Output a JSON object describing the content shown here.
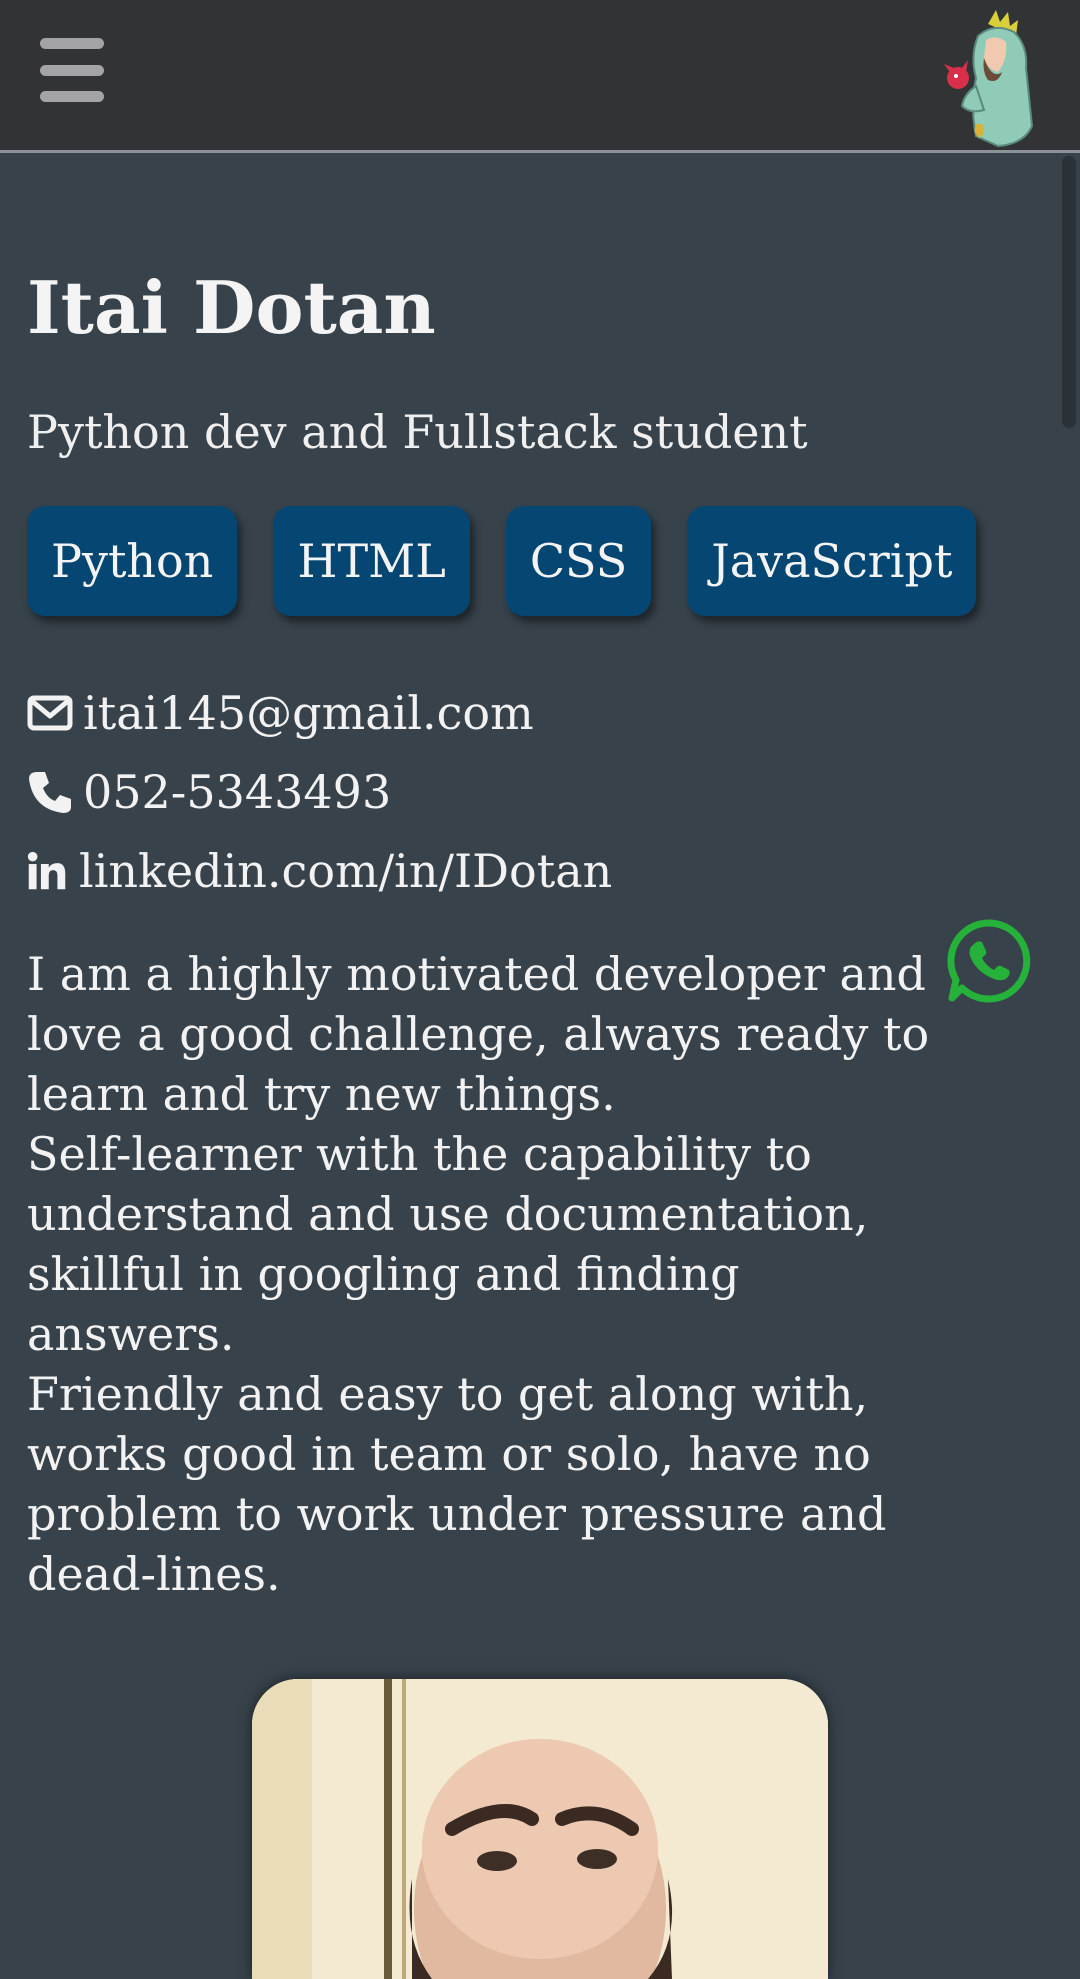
{
  "header": {
    "menu_icon": "hamburger-icon",
    "logo_icon": "character-logo-icon"
  },
  "profile": {
    "name": "Itai Dotan",
    "tagline": "Python dev and Fullstack student"
  },
  "skills": [
    "Python",
    "HTML",
    "CSS",
    "JavaScript"
  ],
  "contacts": {
    "email": "itai145@gmail.com",
    "phone": "052-5343493",
    "linkedin": "linkedin.com/in/IDotan"
  },
  "about": [
    "I am a highly motivated developer and love a good challenge, always ready to learn and try new things.",
    "Self-learner with the capability to understand and use documentation, skillful in googling and finding answers.",
    "Friendly and easy to get along with, works good in team or solo, have no problem to work under pressure and dead-lines."
  ],
  "colors": {
    "background": "#37424a",
    "topbar": "#323335",
    "skill_button": "#064673",
    "whatsapp": "#25b13a"
  }
}
